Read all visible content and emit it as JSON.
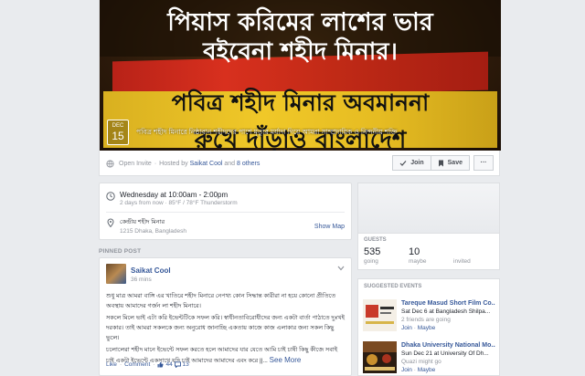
{
  "event": {
    "cover_line1": "পিয়াস করিমের লাশের ভার",
    "cover_line2": "বইবেনা শহীদ মিনার।",
    "cover_line3": "পবিত্র শহীদ মিনার অবমাননা",
    "cover_line4": "রুখে দাঁড়াও বাংলাদেশ",
    "date_month": "DEC",
    "date_day": "15",
    "caption": "পবিত্র শহীদ মিনারে নিষ্ঠাবান শহীদদের পাশে মৃত্যুর মর্যাদা দিয়ে আমরা সাম্প্রদায়িক ও নিন্দনীয় শক্তি",
    "privacy": "Open Invite",
    "hosted_prefix": "Hosted by",
    "host": "Saikat Cool",
    "and": "and",
    "others": "8 others",
    "join_label": "Join",
    "save_label": "Save",
    "more_label": "···"
  },
  "details": {
    "when": "Wednesday at 10:00am - 2:00pm",
    "when_sub": "2 days from now · 85°F / 78°F Thunderstorm",
    "where": "কেন্দ্রীয় শহীদ মিনার",
    "where_sub": "1215 Dhaka, Bangladesh",
    "show_map": "Show Map"
  },
  "pinned": {
    "label": "PINNED POST",
    "author": "Saikat Cool",
    "time": "36 mins",
    "para1": "শুধু মাত্র আমরা বাঙ্গি এর খাতিরে শহীদ মিনারে নেপথ্য কোন সিদ্ধান্ত কারীরা না হয়ে কোনো প্রীতিতে অবস্থায় আমাদের গর্জন লা শহীদ মিনারে।",
    "para2": "সকলে মিলে ভাই এটা করি ইভেন্টটিকে সফল করি। স্বাধীনতাবিরোধীদের জন্য একটা বার্তা পাঠাতে দুঃখই দরকার। তাই আমরা সকলকে জন্য অনুরোধ জানাচ্ছি একতায় কাজে কাজ এলাকার জন্য সকল কিছু ভুলে।",
    "para3": "চলোলেরা শহীদ মানে ইভেন্টে সফল করতে হলে আমাদের যার যেতে আমি চাই চাষী কিছু কীজে সবাই চাই একটা ইভেন্টে একসাথে যদি চাই আমাদের আমাদের এবং করে ||...",
    "see_more": "See More",
    "like": "Like",
    "comment": "Comment",
    "likes_count": "44",
    "comments_count": "13"
  },
  "guests": {
    "title": "GUESTS",
    "going_count": "535",
    "going_label": "going",
    "maybe_count": "10",
    "maybe_label": "maybe",
    "invited_label": "invited"
  },
  "suggested": {
    "title": "SUGGESTED EVENTS",
    "items": [
      {
        "title": "Tareque Masud Short Film Co...",
        "date": "Sat Dec 6 at Bangladesh Shilpa...",
        "going": "2 friends are going",
        "join": "Join",
        "maybe": "Maybe"
      },
      {
        "title": "Dhaka University National Mo...",
        "date": "Sun Dec 21 at University Of Dh...",
        "going": "Quazi might go",
        "join": "Join",
        "maybe": "Maybe"
      }
    ]
  },
  "colors": {
    "accent": "#365899",
    "background": "#e9ebee",
    "muted": "#90949c"
  }
}
